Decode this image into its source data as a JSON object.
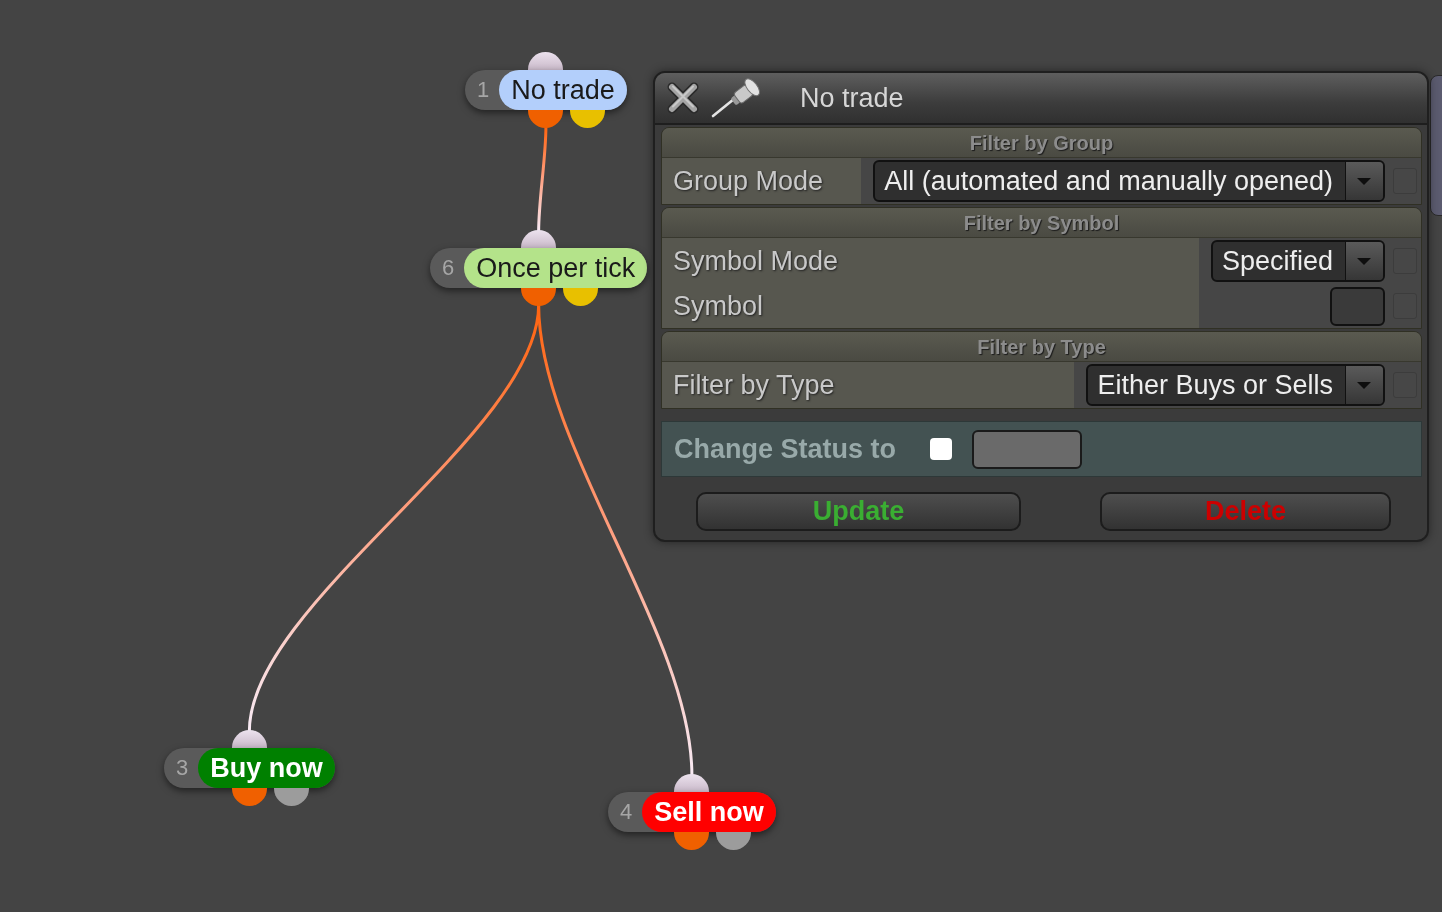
{
  "canvas": {
    "nodes": [
      {
        "number": "1",
        "label": "No trade",
        "color": "#b3cffb",
        "outputs": [
          {
            "color": "#f06000"
          },
          {
            "color": "#e8c000"
          }
        ],
        "children": [
          {
            "number": "6",
            "label": "Once per tick",
            "color": "#b4e38a",
            "outputs": [
              {
                "color": "#f06000"
              },
              {
                "color": "#e8c000"
              }
            ],
            "children": [
              {
                "number": "3",
                "label": "Buy now",
                "color": "#008000",
                "outputs": [
                  {
                    "color": "#f06000"
                  },
                  {
                    "color": "#9c9c9c"
                  }
                ]
              },
              {
                "number": "4",
                "label": "Sell now",
                "color": "#ff0000",
                "outputs": [
                  {
                    "color": "#f06000"
                  },
                  {
                    "color": "#9c9c9c"
                  }
                ]
              }
            ]
          }
        ]
      }
    ]
  },
  "dialog": {
    "title": "No trade",
    "sections": [
      {
        "title": "Filter by Group",
        "rows": [
          {
            "label": "Group Mode",
            "kind": "dropdown",
            "value": "All (automated and manually opened)",
            "checked": false
          }
        ]
      },
      {
        "title": "Filter by Symbol",
        "rows": [
          {
            "label": "Symbol Mode",
            "kind": "dropdown",
            "value": "Specified",
            "checked": false
          },
          {
            "label": "Symbol",
            "kind": "text",
            "checked": false
          }
        ]
      },
      {
        "title": "Filter by Type",
        "rows": [
          {
            "label": "Filter by Type",
            "kind": "dropdown",
            "value": "Either Buys or Sells",
            "checked": false
          }
        ]
      }
    ],
    "status_row": {
      "label": "Change Status to",
      "checked": false
    },
    "buttons": [
      {
        "label": "Update",
        "color": "#3aae32"
      },
      {
        "label": "Delete",
        "color": "#cc0000"
      }
    ]
  }
}
